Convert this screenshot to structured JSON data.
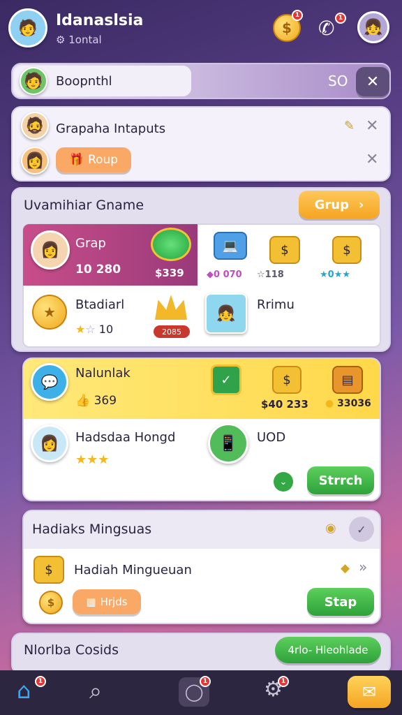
{
  "header": {
    "title": "Idanaslsia",
    "subtitle": "1ontal",
    "coin_badge": "1",
    "phone_badge": "1"
  },
  "search": {
    "value": "Boopnthl",
    "count": "SO"
  },
  "notify": {
    "row1": "Grapaha Intaputs",
    "row2_chip": "Roup"
  },
  "section1": {
    "title": "Uvamihiar Gname",
    "button": "Grup",
    "card_a": {
      "name": "Grap",
      "score": "10 280",
      "price": "$339"
    },
    "tiles": {
      "t1": "0 070",
      "t2": "118",
      "t3": "0"
    },
    "card_b": {
      "name": "Btadiarl",
      "rating": "10",
      "tag": "2085"
    },
    "card_c": {
      "name": "Rrimu"
    }
  },
  "section2": {
    "name": "Nalunlak",
    "value": "369",
    "p1": "$40 233",
    "p2": "33036",
    "card_b": {
      "name": "Hadsdaa Hongd",
      "tag": "UOD",
      "button": "Strrch"
    }
  },
  "section3": {
    "title": "Hadiaks Mingsuas",
    "row": "Hadiah Mingueuan",
    "chip": "Hrjds",
    "button": "Stap"
  },
  "section4": {
    "title": "Nlorlba Cosids",
    "button": "4rlo- Hleohlade"
  },
  "nav": {
    "home_badge": "1",
    "chat_badge": "1",
    "settings_badge": "1"
  }
}
